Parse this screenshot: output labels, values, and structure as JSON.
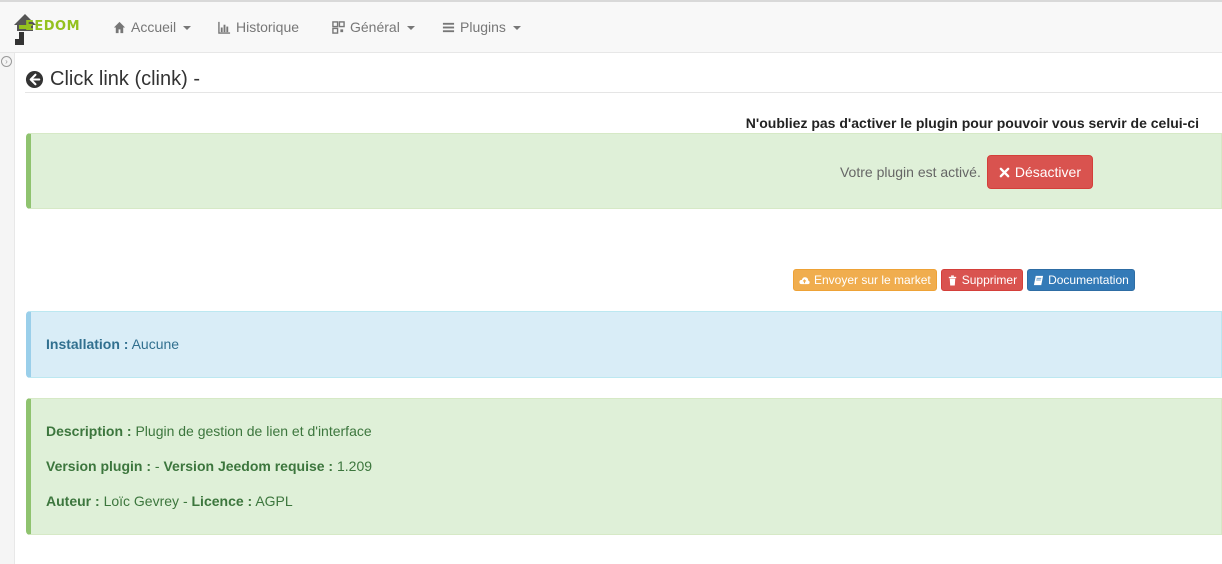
{
  "navbar": {
    "logo_text": "EEDOM",
    "items": [
      {
        "label": "Accueil",
        "icon": "home-icon",
        "dropdown": true
      },
      {
        "label": "Historique",
        "icon": "bar-chart-icon",
        "dropdown": false
      },
      {
        "label": "Général",
        "icon": "qrcode-icon",
        "dropdown": true
      },
      {
        "label": "Plugins",
        "icon": "list-icon",
        "dropdown": true
      }
    ]
  },
  "page": {
    "title": "Click link (clink) -",
    "activation_warning": "N'oubliez pas d'activer le plugin pour pouvoir vous servir de celui-ci"
  },
  "activation": {
    "status_text": "Votre plugin est activé.",
    "deactivate_label": "Désactiver"
  },
  "actions": {
    "market_label": "Envoyer sur le market",
    "delete_label": "Supprimer",
    "doc_label": "Documentation"
  },
  "installation": {
    "label": "Installation :",
    "value": "Aucune"
  },
  "details": {
    "description_label": "Description :",
    "description_value": "Plugin de gestion de lien et d'interface",
    "version_label": "Version plugin :",
    "version_value": "-",
    "required_label": "Version Jeedom requise :",
    "required_value": "1.209",
    "author_label": "Auteur :",
    "author_value": "Loïc Gevrey",
    "separator": "-",
    "licence_label": "Licence :",
    "licence_value": "AGPL"
  },
  "colors": {
    "success_bg": "#dff0d8",
    "info_bg": "#d9edf7",
    "danger": "#d9534f",
    "warning": "#f0ad4e",
    "primary": "#337ab7",
    "brand": "#94c11f"
  }
}
